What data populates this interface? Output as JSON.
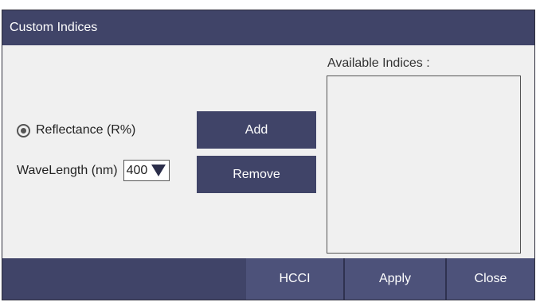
{
  "dialog": {
    "title": "Custom Indices",
    "radio_label": "Reflectance (R%)",
    "radio_selected": true,
    "wavelength_label": "WaveLength (nm)",
    "wavelength_value": "400",
    "add_label": "Add",
    "remove_label": "Remove",
    "available_label": "Available Indices :",
    "available_items": []
  },
  "footer": {
    "hcci_label": "HCCI",
    "apply_label": "Apply",
    "close_label": "Close"
  },
  "colors": {
    "header_bg": "#404468",
    "button_bg": "#404468",
    "footer_button_bg": "#4d527a",
    "panel_bg": "#f0f0f0"
  },
  "icons": {
    "radio": "radio-selected-icon",
    "dropdown": "triangle-down-icon"
  }
}
